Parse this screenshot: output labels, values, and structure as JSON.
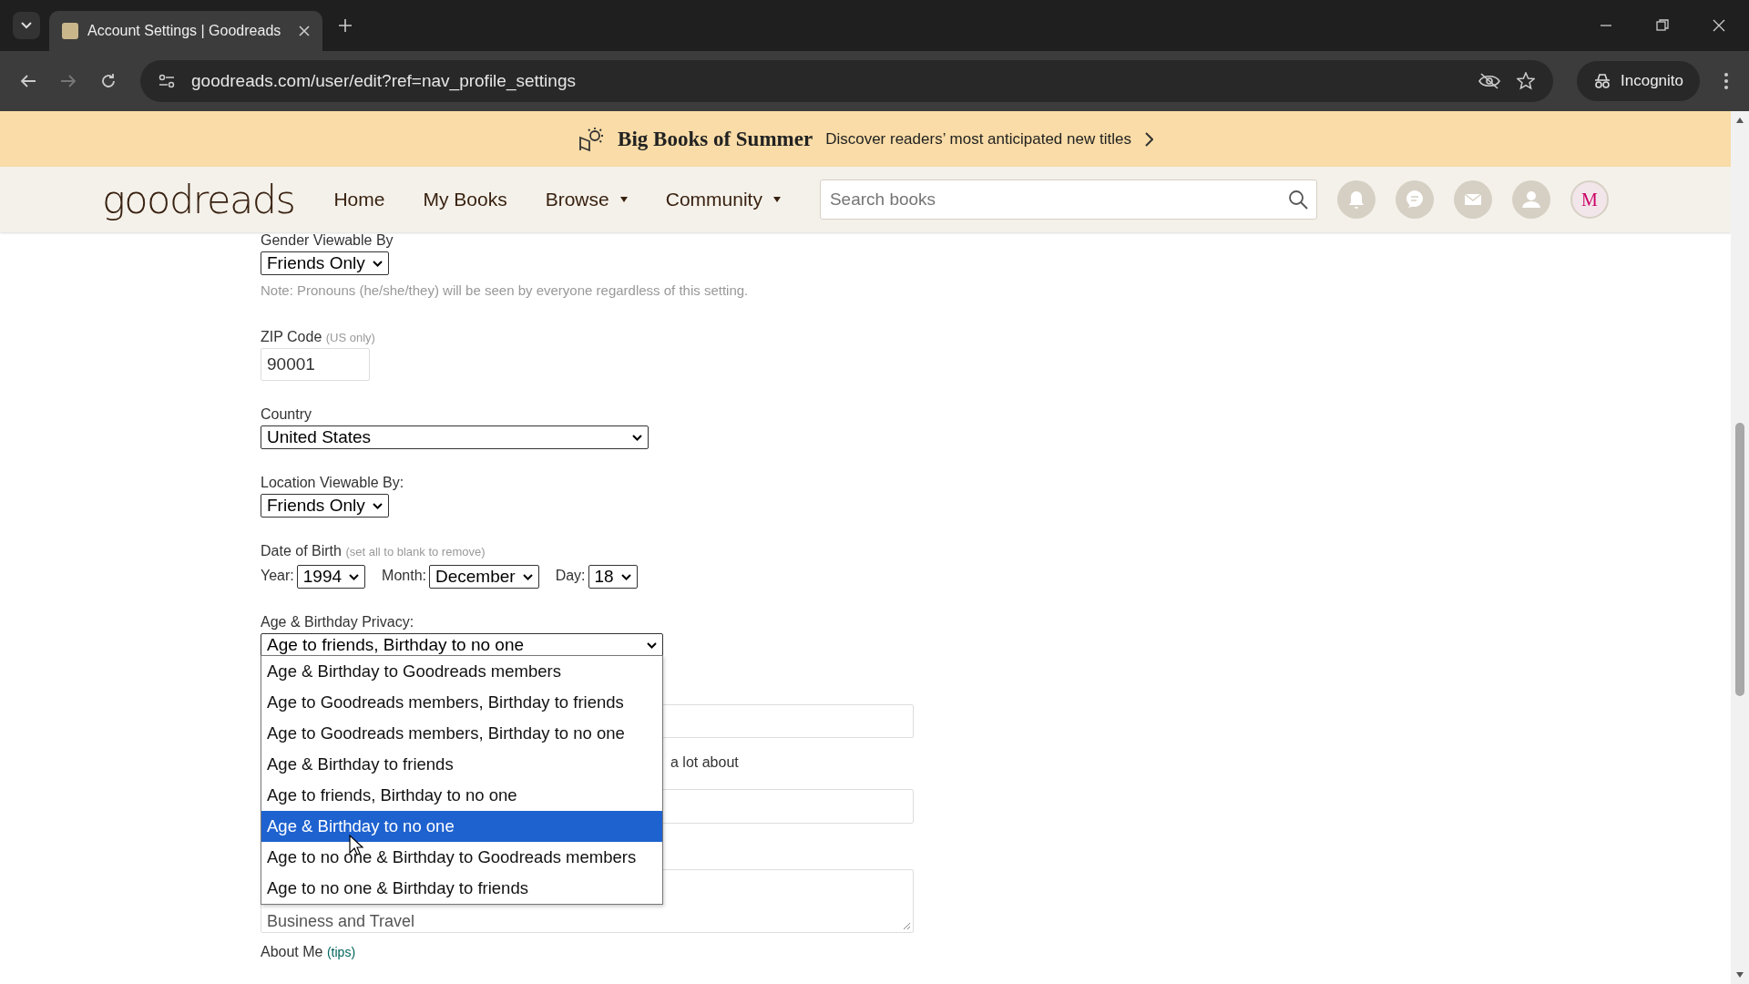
{
  "browser": {
    "tab_title": "Account Settings | Goodreads",
    "url": "goodreads.com/user/edit?ref=nav_profile_settings",
    "incognito_label": "Incognito"
  },
  "banner": {
    "title": "Big Books of Summer",
    "text": "Discover readers’ most anticipated new titles"
  },
  "nav": {
    "logo": "goodreads",
    "links": [
      {
        "label": "Home",
        "dropdown": false
      },
      {
        "label": "My Books",
        "dropdown": false
      },
      {
        "label": "Browse",
        "dropdown": true
      },
      {
        "label": "Community",
        "dropdown": true
      }
    ],
    "search": {
      "placeholder": "Search books"
    },
    "avatar_letter": "M"
  },
  "form": {
    "gender_label": "Gender Viewable By",
    "gender_value": "Friends Only",
    "pronoun_note": "Note: Pronouns (he/she/they) will be seen by everyone regardless of this setting.",
    "zip_label": "ZIP Code",
    "zip_hint": "(US only)",
    "zip_value": "90001",
    "country_label": "Country",
    "country_value": "United States",
    "location_label": "Location Viewable By:",
    "location_value": "Friends Only",
    "dob_label": "Date of Birth",
    "dob_hint": "(set all to blank to remove)",
    "year_label": "Year:",
    "year_value": "1994",
    "month_label": "Month:",
    "month_value": "December",
    "day_label": "Day:",
    "day_value": "18",
    "privacy_label": "Age & Birthday Privacy:",
    "privacy_value": "Age to friends, Birthday to no one",
    "privacy_options": [
      {
        "label": "Age & Birthday to Goodreads members",
        "selected": false
      },
      {
        "label": "Age to Goodreads members, Birthday to friends",
        "selected": false
      },
      {
        "label": "Age to Goodreads members, Birthday to no one",
        "selected": false
      },
      {
        "label": "Age & Birthday to friends",
        "selected": false
      },
      {
        "label": "Age to friends, Birthday to no one",
        "selected": false
      },
      {
        "label": "Age & Birthday to no one",
        "selected": true
      },
      {
        "label": "Age to no one & Birthday to Goodreads members",
        "selected": false
      },
      {
        "label": "Age to no one & Birthday to friends",
        "selected": false
      }
    ],
    "hidden_text": "a lot about",
    "interests_value": "Business and Travel",
    "about_label": "About Me",
    "about_link": "(tips)"
  }
}
